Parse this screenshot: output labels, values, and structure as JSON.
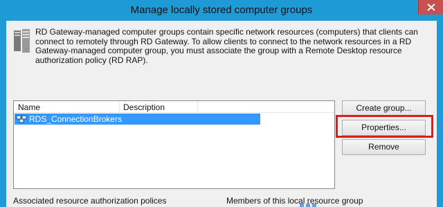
{
  "window": {
    "title": "Manage locally stored computer groups",
    "close_glyph": "×"
  },
  "info": {
    "text": "RD Gateway-managed computer groups contain specific network resources (computers) that clients can connect to remotely through RD Gateway. To allow clients to connect to the network resources in a RD Gateway-managed computer group, you must associate the group with a Remote Desktop resource authorization policy (RD RAP).",
    "icon": "server-stack-icon"
  },
  "groups_list": {
    "columns": [
      "Name",
      "Description"
    ],
    "rows": [
      {
        "name": "RDS_ConnectionBrokers",
        "description": "",
        "selected": true,
        "icon": "computer-group-icon"
      }
    ]
  },
  "buttons": {
    "create_group": "Create group...",
    "properties": "Properties...",
    "remove": "Remove"
  },
  "labels": {
    "associated_policies": "Associated resource authorization polices",
    "members": "Members of this local resource group"
  },
  "colors": {
    "titlebar": "#1e9ad6",
    "selection": "#3399ff",
    "highlight_box": "#e01b1b",
    "close_button": "#c75050"
  }
}
